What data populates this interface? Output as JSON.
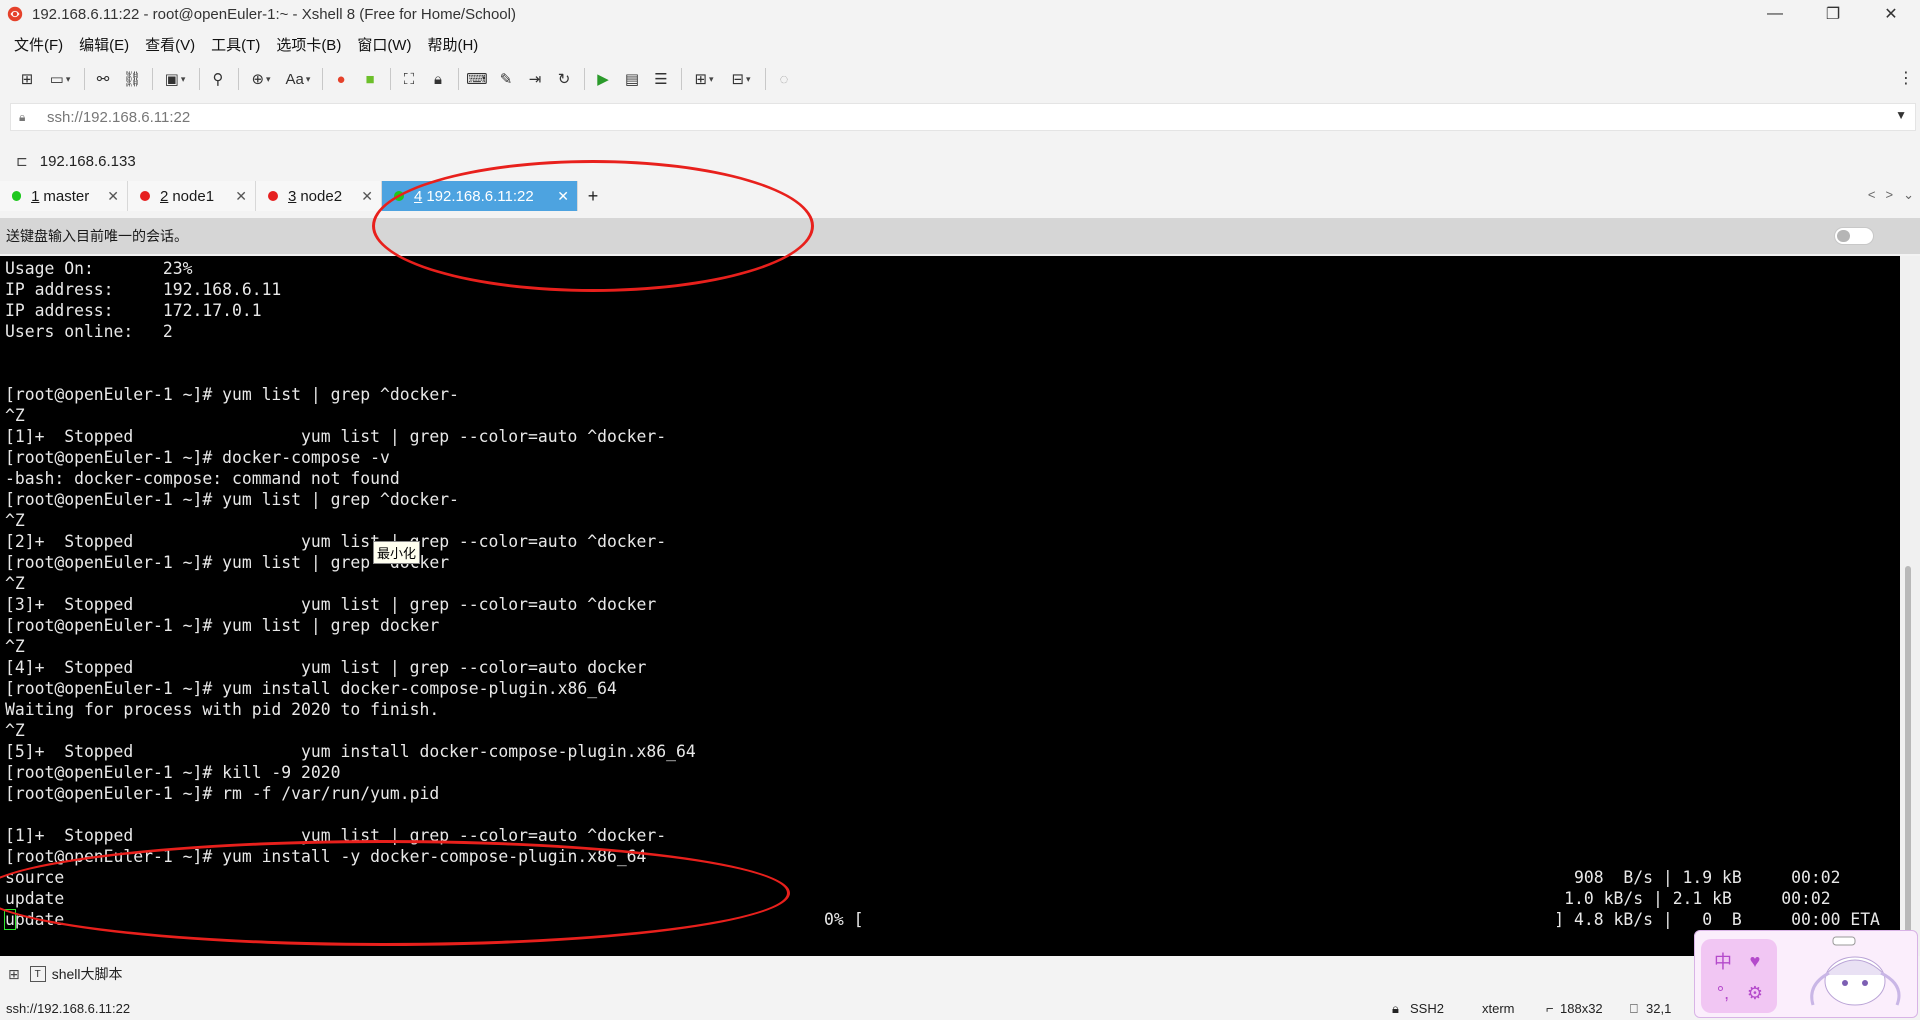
{
  "window": {
    "title": "192.168.6.11:22 - root@openEuler-1:~ - Xshell 8 (Free for Home/School)",
    "controls": {
      "minimize": "—",
      "maximize": "❐",
      "close": "✕"
    }
  },
  "menu": [
    "文件(F)",
    "编辑(E)",
    "查看(V)",
    "工具(T)",
    "选项卡(B)",
    "窗口(W)",
    "帮助(H)"
  ],
  "toolbar": {
    "font_label": "Aa"
  },
  "address": {
    "url": "ssh://192.168.6.11:22"
  },
  "session": {
    "label": "192.168.6.133"
  },
  "tabs": [
    {
      "num": "1",
      "label": "master",
      "dot_color": "#1ec81e",
      "active": false
    },
    {
      "num": "2",
      "label": "node1",
      "dot_color": "#e62020",
      "active": false
    },
    {
      "num": "3",
      "label": "node2",
      "dot_color": "#e62020",
      "active": false
    },
    {
      "num": "4",
      "label": "192.168.6.11:22",
      "dot_color": "#1ec81e",
      "active": true
    }
  ],
  "tab_add": "+",
  "sendbar": {
    "text": "送键盘输入目前唯一的会话。"
  },
  "terminal": {
    "lines": [
      "Usage On:       23%",
      "IP address:     192.168.6.11",
      "IP address:     172.17.0.1",
      "Users online:   2",
      "",
      "",
      "[root@openEuler-1 ~]# yum list | grep ^docker-",
      "^Z",
      "[1]+  Stopped                 yum list | grep --color=auto ^docker-",
      "[root@openEuler-1 ~]# docker-compose -v",
      "-bash: docker-compose: command not found",
      "[root@openEuler-1 ~]# yum list | grep ^docker-",
      "^Z",
      "[2]+  Stopped                 yum list | grep --color=auto ^docker-",
      "[root@openEuler-1 ~]# yum list | grep  docker",
      "^Z",
      "[3]+  Stopped                 yum list | grep --color=auto ^docker",
      "[root@openEuler-1 ~]# yum list | grep docker",
      "^Z",
      "[4]+  Stopped                 yum list | grep --color=auto docker",
      "[root@openEuler-1 ~]# yum install docker-compose-plugin.x86_64",
      "Waiting for process with pid 2020 to finish.",
      "^Z",
      "[5]+  Stopped                 yum install docker-compose-plugin.x86_64",
      "[root@openEuler-1 ~]# kill -9 2020",
      "[root@openEuler-1 ~]# rm -f /var/run/yum.pid",
      "",
      "[1]+  Stopped                 yum list | grep --color=auto ^docker-",
      "[root@openEuler-1 ~]# yum install -y docker-compose-plugin.x86_64",
      "source                                                                                                                                                         908  B/s | 1.9 kB     00:02",
      "update                                                                                                                                                        1.0 kB/s | 2.1 kB     00:02"
    ],
    "last_line_cursor_char": "u",
    "last_line_rest": "pdate                                                                             0% [                                                                      ] 4.8 kB/s |   0  B     00:00 ETA"
  },
  "tooltip": "最小化",
  "compose": {
    "script_label": "shell大脚本"
  },
  "status": {
    "url": "ssh://192.168.6.11:22",
    "protocol": "SSH2",
    "term": "xterm",
    "size": "188x32",
    "cursor": "32,1"
  },
  "widget": {
    "ime_chars": [
      "中",
      "♥",
      "°,",
      "⚙"
    ]
  },
  "colors": {
    "active_tab": "#4da3e0",
    "annotation": "#e8201c",
    "terminal_bg": "#000000"
  }
}
